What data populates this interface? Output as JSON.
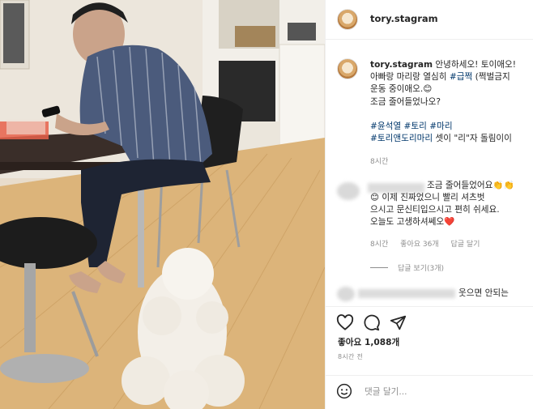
{
  "post": {
    "username": "tory.stagram",
    "caption_lines": [
      "안녕하세오! 토이애오!",
      "아빠랑 마리랑 열심히 ",
      "운동 중이애오.",
      "조금 줄어들었나오?"
    ],
    "caption_hashtag": "#급쩍",
    "caption_tail": " (쩍벌금지",
    "caption_emoji": "😊",
    "hashtag_lines": [
      [
        "#윤석열",
        "#토리",
        "#마리"
      ],
      [
        "#토리앤도리마리"
      ]
    ],
    "hashtag_suffix": " 셋이 \"리\"자 돌림이이",
    "caption_time": "8시간"
  },
  "comment": {
    "lines": [
      "조금 줄어들었어요👏👏",
      "😊 이제 진짜었으니 빨리 셔츠벗",
      "으시고 문신티입으시고 편히 쉬세요.",
      "오늘도 고생하셔쎄오❤️"
    ],
    "time": "8시간",
    "likes": "좋아요 36개",
    "reply": "답글 달기",
    "view_replies": "답글 보기(3개)"
  },
  "comment2": {
    "text": "웃으면 안되는"
  },
  "actions": {
    "likes_label": "좋아요",
    "likes_count": "1,088개",
    "post_time": "8시간 전",
    "add_comment_placeholder": "댓글 달기..."
  },
  "icons": [
    "heart-icon",
    "comment-icon",
    "share-icon",
    "emoji-icon"
  ],
  "colors": {
    "text": "#262626",
    "muted": "#8e8e8e",
    "link": "#00376b",
    "border": "#efefef",
    "heart": "#e0245e"
  }
}
